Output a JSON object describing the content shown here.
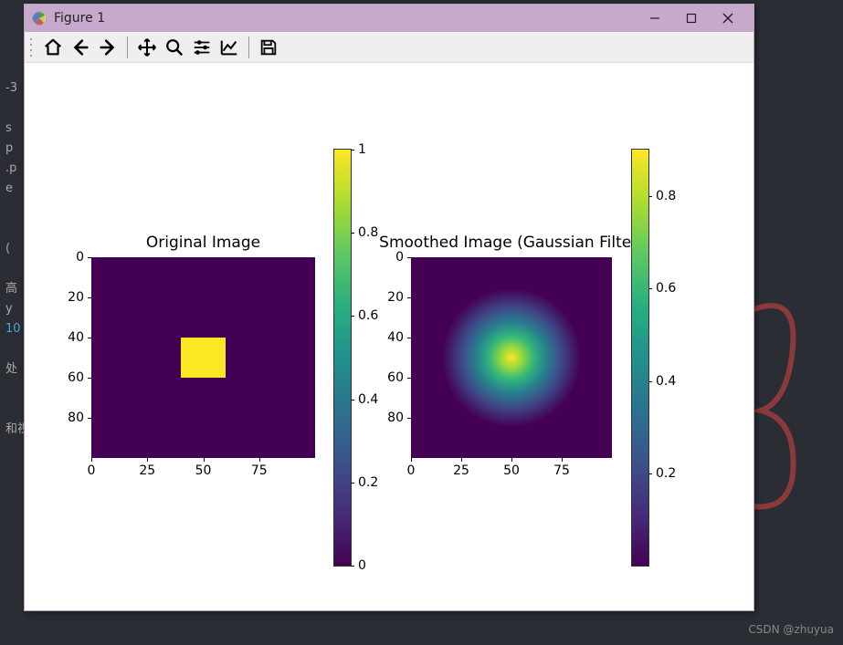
{
  "window": {
    "title": "Figure 1"
  },
  "toolbar": {
    "home": "Home",
    "back": "Back",
    "forward": "Forward",
    "pan": "Pan",
    "zoom": "Zoom",
    "subplots": "Configure subplots",
    "edit": "Edit axis",
    "save": "Save figure"
  },
  "behind_text": {
    "lines": [
      "-3",
      "",
      "s",
      "p",
      ".p",
      "e",
      "",
      "(",
      "",
      "高",
      "y",
      "10",
      "",
      "处",
      "",
      "和视"
    ]
  },
  "watermark": "CSDN @zhuyua",
  "chart_data": [
    {
      "type": "heatmap",
      "title": "Original Image",
      "x_range": [
        0,
        100
      ],
      "y_range": [
        0,
        100
      ],
      "xticks": [
        0,
        25,
        50,
        75
      ],
      "yticks": [
        0,
        20,
        40,
        60,
        80
      ],
      "description": "100x100 array of zeros with a solid square of value 1.0 from approx (40,40) to (60,60)",
      "colorbar": {
        "ticks": [
          0.0,
          0.2,
          0.4,
          0.6,
          0.8,
          1.0
        ],
        "vmin": 0.0,
        "vmax": 1.0,
        "cmap": "viridis"
      }
    },
    {
      "type": "heatmap",
      "title": "Smoothed Image (Gaussian Filter)",
      "x_range": [
        0,
        100
      ],
      "y_range": [
        0,
        100
      ],
      "xticks": [
        0,
        25,
        50,
        75
      ],
      "yticks": [
        0,
        20,
        40,
        60,
        80
      ],
      "description": "Gaussian-blurred version of the left image; peak ≈0.9 near center (50,50), falling smoothly to 0",
      "colorbar": {
        "ticks": [
          0.2,
          0.4,
          0.6,
          0.8
        ],
        "vmin": 0.0,
        "vmax": 0.9,
        "cmap": "viridis"
      }
    }
  ]
}
